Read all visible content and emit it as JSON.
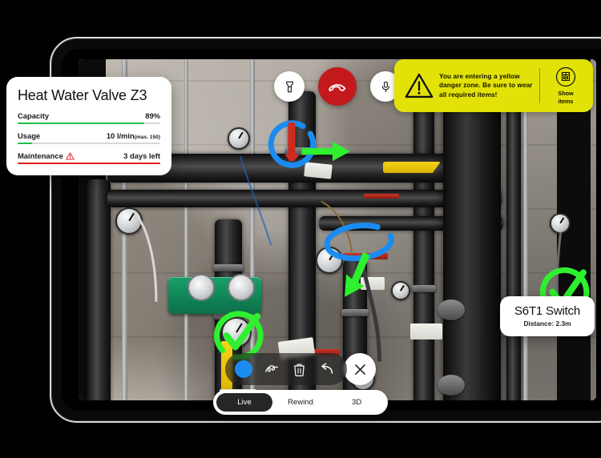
{
  "device": {
    "name": "tablet-device"
  },
  "call_controls": [
    {
      "name": "flashlight-button",
      "icon": "flashlight-icon",
      "label": "Flashlight"
    },
    {
      "name": "end-call-button",
      "icon": "hang-up-icon",
      "label": "End call"
    },
    {
      "name": "microphone-button",
      "icon": "microphone-icon",
      "label": "Microphone"
    }
  ],
  "warning_banner": {
    "icon": "warning-triangle-icon",
    "text": "You are entering a yellow danger zone. Be sure to wear all required items!",
    "action_icon": "safety-vest-icon",
    "action_label_line1": "Show",
    "action_label_line2": "items",
    "color": "#e2e209"
  },
  "info_card": {
    "title": "Heat Water Valve Z3",
    "metrics": [
      {
        "label": "Capacity",
        "value": "89%",
        "sub": "",
        "percent": 89,
        "color": "#1fc24a",
        "warning": false
      },
      {
        "label": "Usage",
        "value": "10 l/min",
        "sub": "(max. 150)",
        "percent": 10,
        "color": "#1fc24a",
        "warning": false
      },
      {
        "label": "Maintenance",
        "value": "3 days left",
        "sub": "",
        "percent": 100,
        "color": "#e01b1b",
        "warning": true
      }
    ]
  },
  "poi_card": {
    "title": "S6T1 Switch",
    "distance": "Distance: 2.3m"
  },
  "draw_toolbar": {
    "color_swatch": "#1a8cf0",
    "tools": [
      {
        "name": "scribble-tool-button",
        "icon": "scribble-icon",
        "label": "Draw"
      },
      {
        "name": "delete-button",
        "icon": "trash-icon",
        "label": "Delete"
      },
      {
        "name": "undo-button",
        "icon": "undo-icon",
        "label": "Undo"
      }
    ],
    "close_label": "Close",
    "close_icon": "close-icon"
  },
  "mode_switch": {
    "options": [
      {
        "label": "Live",
        "active": true
      },
      {
        "label": "Rewind",
        "active": false
      },
      {
        "label": "3D",
        "active": false
      }
    ]
  },
  "annotations": [
    {
      "name": "annotation-blue-circle-valve",
      "type": "circle",
      "color": "#1a8cf0"
    },
    {
      "name": "annotation-green-arrow-right",
      "type": "arrow",
      "color": "#2ef02e"
    },
    {
      "name": "annotation-blue-ellipse-label",
      "type": "ellipse",
      "color": "#1a8cf0"
    },
    {
      "name": "annotation-green-arrow-down",
      "type": "arrow",
      "color": "#2ef02e"
    },
    {
      "name": "annotation-green-check-gauge-left",
      "type": "check",
      "color": "#2ef02e"
    },
    {
      "name": "annotation-green-check-gauge-right",
      "type": "check",
      "color": "#2ef02e"
    }
  ]
}
